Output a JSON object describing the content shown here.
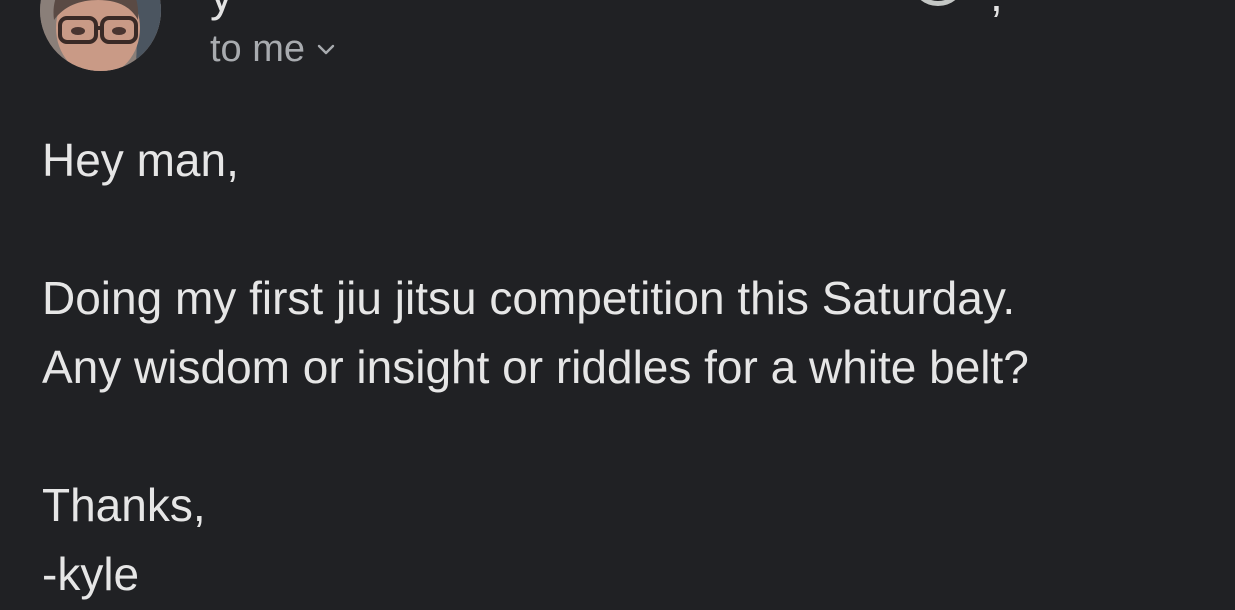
{
  "email": {
    "header": {
      "sender_clipped": "y",
      "time_clipped": ", ",
      "avatar_icon": "sender-avatar"
    },
    "recipient": {
      "label": "to me",
      "expand_icon": "chevron-down-icon"
    },
    "body": {
      "greeting": "Hey man,",
      "line1": "Doing my first jiu jitsu competition this Saturday.",
      "line2": "Any wisdom or insight or riddles for a white belt?",
      "closing": "Thanks,",
      "signature": "-kyle"
    }
  },
  "colors": {
    "background": "#202124",
    "text": "#e6e6e6",
    "secondary_text": "#a8abaf"
  }
}
